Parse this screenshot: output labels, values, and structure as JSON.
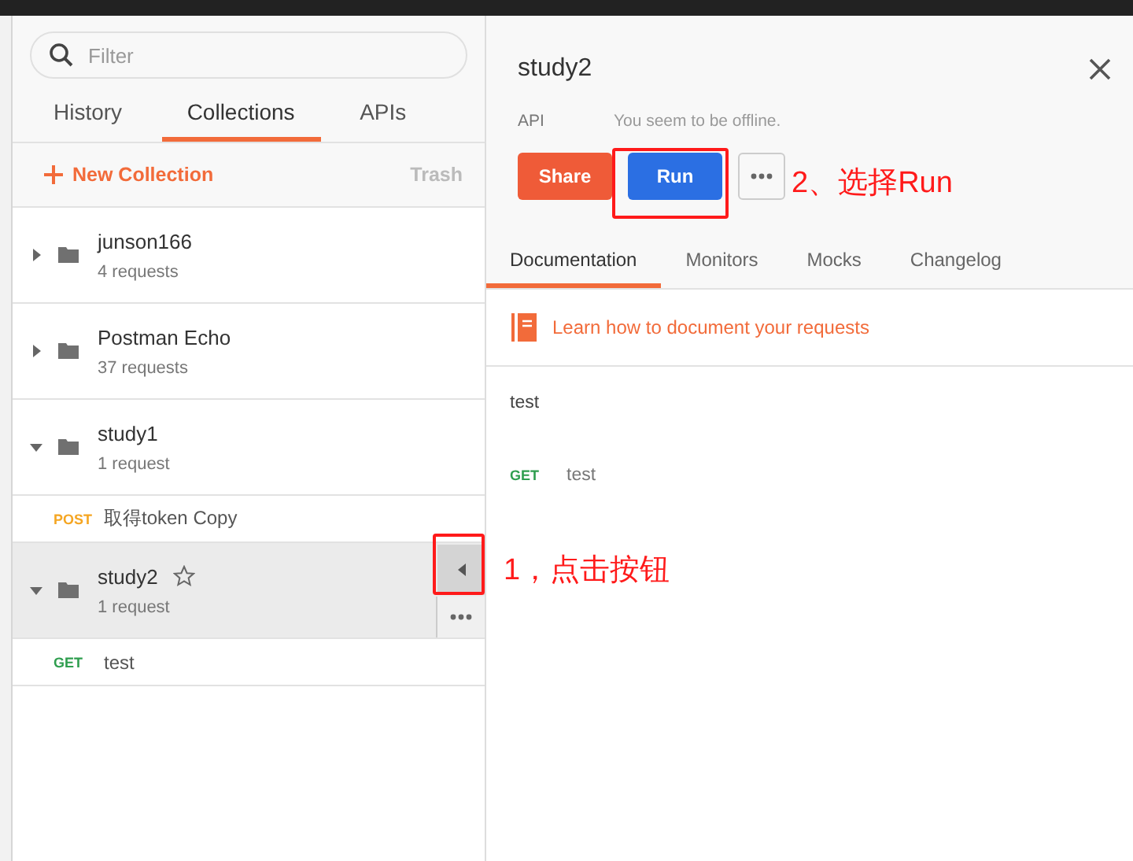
{
  "search": {
    "placeholder": "Filter"
  },
  "tabs": [
    {
      "label": "History",
      "selected": false
    },
    {
      "label": "Collections",
      "selected": true
    },
    {
      "label": "APIs",
      "selected": false
    }
  ],
  "new_collection": "New Collection",
  "trash": "Trash",
  "collections": [
    {
      "name": "junson166",
      "count": "4 requests",
      "expanded": false,
      "selected": false
    },
    {
      "name": "Postman Echo",
      "count": "37 requests",
      "expanded": false,
      "selected": false
    },
    {
      "name": "study1",
      "count": "1 request",
      "expanded": true,
      "selected": false,
      "requests": [
        {
          "method": "POST",
          "name": "取得token Copy"
        }
      ]
    },
    {
      "name": "study2",
      "count": "1 request",
      "expanded": true,
      "selected": true,
      "requests": [
        {
          "method": "GET",
          "name": "test"
        }
      ]
    }
  ],
  "detail": {
    "title": "study2",
    "type_label": "API",
    "status": "You seem to be offline.",
    "buttons": [
      {
        "label": "Share",
        "kind": "share"
      },
      {
        "label": "Run",
        "kind": "run"
      }
    ],
    "tabs": [
      {
        "label": "Documentation",
        "selected": true
      },
      {
        "label": "Monitors",
        "selected": false
      },
      {
        "label": "Mocks",
        "selected": false
      },
      {
        "label": "Changelog",
        "selected": false
      }
    ],
    "learn_link": "Learn how to document your requests",
    "description": "test",
    "requests": [
      {
        "method": "GET",
        "name": "test"
      }
    ]
  },
  "annotations": [
    {
      "text": "1，点击按钮"
    },
    {
      "text": "2、选择Run"
    }
  ]
}
